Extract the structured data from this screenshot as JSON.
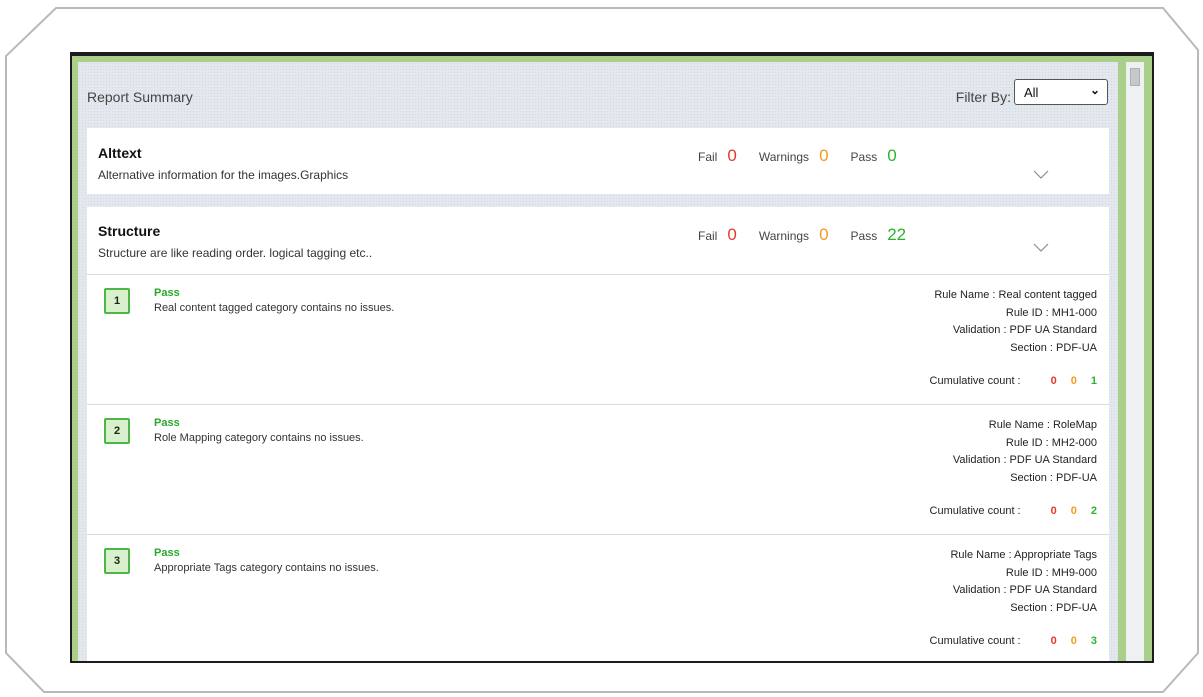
{
  "report": {
    "title": "Report Summary",
    "filter_label": "Filter By:",
    "filter_value": "All"
  },
  "categories": [
    {
      "name": "Alttext",
      "description": "Alternative information for the images.Graphics",
      "fail_label": "Fail",
      "fail": "0",
      "warnings_label": "Warnings",
      "warnings": "0",
      "pass_label": "Pass",
      "pass": "0"
    },
    {
      "name": "Structure",
      "description": "Structure are like reading order. logical tagging etc..",
      "fail_label": "Fail",
      "fail": "0",
      "warnings_label": "Warnings",
      "warnings": "0",
      "pass_label": "Pass",
      "pass": "22"
    }
  ],
  "rules": [
    {
      "number": "1",
      "status": "Pass",
      "description": "Real content tagged category contains no issues.",
      "rule_name": "Rule Name : Real content tagged",
      "rule_id": "Rule ID : MH1-000",
      "validation": "Validation : PDF UA Standard",
      "section": "Section : PDF-UA",
      "cumulative_label": "Cumulative count :",
      "cum_fail": "0",
      "cum_warn": "0",
      "cum_pass": "1"
    },
    {
      "number": "2",
      "status": "Pass",
      "description": "Role Mapping category contains no issues.",
      "rule_name": "Rule Name : RoleMap",
      "rule_id": "Rule ID : MH2-000",
      "validation": "Validation : PDF UA Standard",
      "section": "Section : PDF-UA",
      "cumulative_label": "Cumulative count :",
      "cum_fail": "0",
      "cum_warn": "0",
      "cum_pass": "2"
    },
    {
      "number": "3",
      "status": "Pass",
      "description": "Appropriate Tags category contains no issues.",
      "rule_name": "Rule Name : Appropriate Tags",
      "rule_id": "Rule ID : MH9-000",
      "validation": "Validation : PDF UA Standard",
      "section": "Section : PDF-UA",
      "cumulative_label": "Cumulative count :",
      "cum_fail": "0",
      "cum_warn": "0",
      "cum_pass": "3"
    }
  ],
  "colors": {
    "fail": "#e23b2e",
    "warning": "#f39a1f",
    "pass": "#2cb32c",
    "frame_accent": "#a9cf8a"
  },
  "icons": {
    "expand": "chevron-down-icon",
    "dropdown": "chevron-down-icon"
  }
}
